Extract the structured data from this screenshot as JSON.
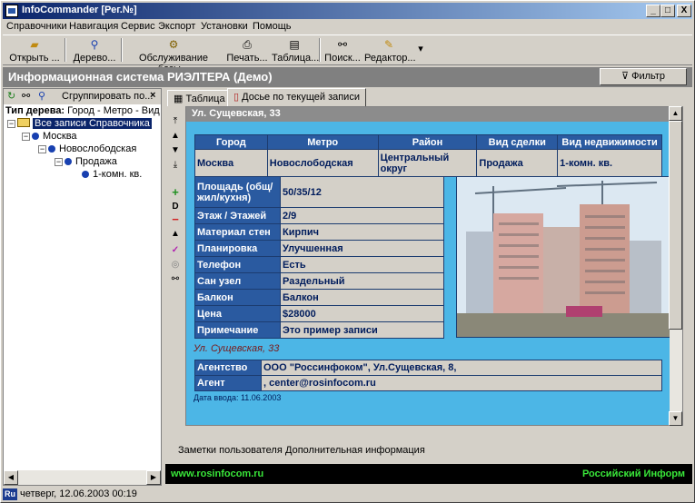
{
  "window": {
    "title": "InfoCommander [Рег.№]",
    "min": "_",
    "max": "□",
    "close": "X"
  },
  "menu": [
    "Справочники",
    "Навигация",
    "Сервис",
    "Экспорт",
    "Установки",
    "Помощь"
  ],
  "toolbar": {
    "open": "Открыть ...",
    "tree": "Дерево...",
    "service": "Обслуживание базы...",
    "print": "Печать...",
    "table": "Таблица...",
    "search": "Поиск...",
    "editor": "Редактор..."
  },
  "header": {
    "title": "Информационная система РИЭЛТЕРА (Демо)",
    "filter": "Фильтр"
  },
  "left": {
    "group_label": "Сгруппировать по...",
    "close": "×",
    "type_label": "Тип дерева:",
    "type_value": "Город - Метро - Вид с",
    "tree": [
      {
        "label": "Все записи Справочника",
        "level": 0
      },
      {
        "label": "Москва",
        "level": 1
      },
      {
        "label": "Новослободская",
        "level": 2
      },
      {
        "label": "Продажа",
        "level": 3
      },
      {
        "label": "1-комн. кв.",
        "level": 4
      }
    ]
  },
  "tabs": [
    "Таблица",
    "Досье по текущей записи"
  ],
  "record": {
    "title": "Ул. Сущевская, 33",
    "columns": [
      "Город",
      "Метро",
      "Район",
      "Вид сделки",
      "Вид недвижимости"
    ],
    "values": [
      "Москва",
      "Новослободская",
      "Центральный округ",
      "Продажа",
      "1-комн. кв."
    ],
    "attrs": [
      {
        "k": "Площадь (общ/жил/кухня)",
        "v": "50/35/12"
      },
      {
        "k": "Этаж / Этажей",
        "v": "2/9"
      },
      {
        "k": "Материал стен",
        "v": "Кирпич"
      },
      {
        "k": "Планировка",
        "v": "Улучшенная"
      },
      {
        "k": "Телефон",
        "v": "Есть"
      },
      {
        "k": "Сан узел",
        "v": "Раздельный"
      },
      {
        "k": "Балкон",
        "v": "Балкон"
      },
      {
        "k": "Цена",
        "v": "$28000"
      },
      {
        "k": "Примечание",
        "v": "Это пример записи"
      }
    ],
    "street_repeat": "Ул. Сущевская, 33",
    "agency_label": "Агентство",
    "agency_value": "ООО \"Россинфоком\", Ул.Сущевская, 8,",
    "agent_label": "Агент",
    "agent_value": ", center@rosinfocom.ru",
    "date": "Дата ввода: 11.06.2003"
  },
  "bottom_tabs": [
    "Заметки пользователя",
    "Дополнительная информация"
  ],
  "footer": {
    "left": "www.rosinfocom.ru",
    "right": "Российский Информ"
  },
  "status": {
    "lang": "Ru",
    "text": "четверг, 12.06.2003 00:19"
  }
}
